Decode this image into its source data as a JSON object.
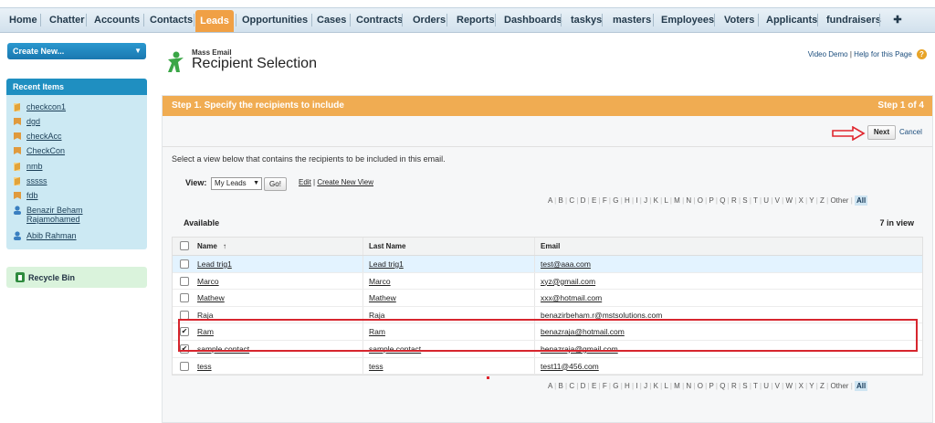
{
  "nav": {
    "tabs": [
      "Home",
      "Chatter",
      "Accounts",
      "Contacts",
      "Leads",
      "Opportunities",
      "Cases",
      "Contracts",
      "Orders",
      "Reports",
      "Dashboards",
      "taskys",
      "masters",
      "Employees",
      "Voters",
      "Applicants",
      "fundraisers",
      "✚"
    ],
    "active": "Leads"
  },
  "sidebar": {
    "create_new": "Create New...",
    "recent_title": "Recent Items",
    "recent": [
      {
        "label": "checkcon1",
        "icon": "lead-icon"
      },
      {
        "label": "dgd",
        "icon": "account-icon"
      },
      {
        "label": "checkAcc",
        "icon": "account-icon"
      },
      {
        "label": "CheckCon",
        "icon": "account-icon"
      },
      {
        "label": "nmb",
        "icon": "lead-icon"
      },
      {
        "label": "sssss",
        "icon": "lead-icon"
      },
      {
        "label": "fdb",
        "icon": "account-icon"
      },
      {
        "label": "Benazir Beham Rajamohamed",
        "icon": "contact-icon"
      },
      {
        "label": "Abib Rahman",
        "icon": "contact-icon"
      }
    ],
    "recycle": "Recycle Bin"
  },
  "header": {
    "subtitle": "Mass Email",
    "title": "Recipient Selection",
    "video_demo": "Video Demo",
    "help": "Help for this Page",
    "sep": "|"
  },
  "step": {
    "title": "Step 1. Specify the recipients to include",
    "count": "Step 1 of 4",
    "next": "Next",
    "cancel": "Cancel",
    "instruction": "Select a view below that contains the recipients to be included in this email."
  },
  "view": {
    "label": "View:",
    "selected": "My Leads",
    "go": "Go!",
    "edit": "Edit",
    "create_new": "Create New View",
    "sep": "|"
  },
  "alphabet": [
    "A",
    "B",
    "C",
    "D",
    "E",
    "F",
    "G",
    "H",
    "I",
    "J",
    "K",
    "L",
    "M",
    "N",
    "O",
    "P",
    "Q",
    "R",
    "S",
    "T",
    "U",
    "V",
    "W",
    "X",
    "Y",
    "Z",
    "Other",
    "All"
  ],
  "list": {
    "available": "Available",
    "in_view": "7 in view",
    "columns": {
      "name": "Name",
      "sort": "↑",
      "last": "Last Name",
      "email": "Email"
    },
    "rows": [
      {
        "name": "Lead trig1",
        "last": "Lead trig1",
        "email": "test@aaa.com",
        "checked": false
      },
      {
        "name": "Marco",
        "last": "Marco",
        "email": "xyz@gmail.com",
        "checked": false
      },
      {
        "name": "Mathew",
        "last": "Mathew",
        "email": "xxx@hotmail.com",
        "checked": false
      },
      {
        "name": "Raja",
        "last": "Raja",
        "email": "benazirbeham.r@mstsolutions.com",
        "checked": false
      },
      {
        "name": "Ram",
        "last": "Ram",
        "email": "benazraja@hotmail.com",
        "checked": true
      },
      {
        "name": "sample contact",
        "last": "sample contact",
        "email": "benazraja@gmail.com",
        "checked": true
      },
      {
        "name": "tess",
        "last": "tess",
        "email": "test11@456.com",
        "checked": false
      }
    ]
  },
  "colors": {
    "accent": "#f0ac52",
    "nav_active": "#f0a045",
    "highlight": "#d7262e"
  }
}
